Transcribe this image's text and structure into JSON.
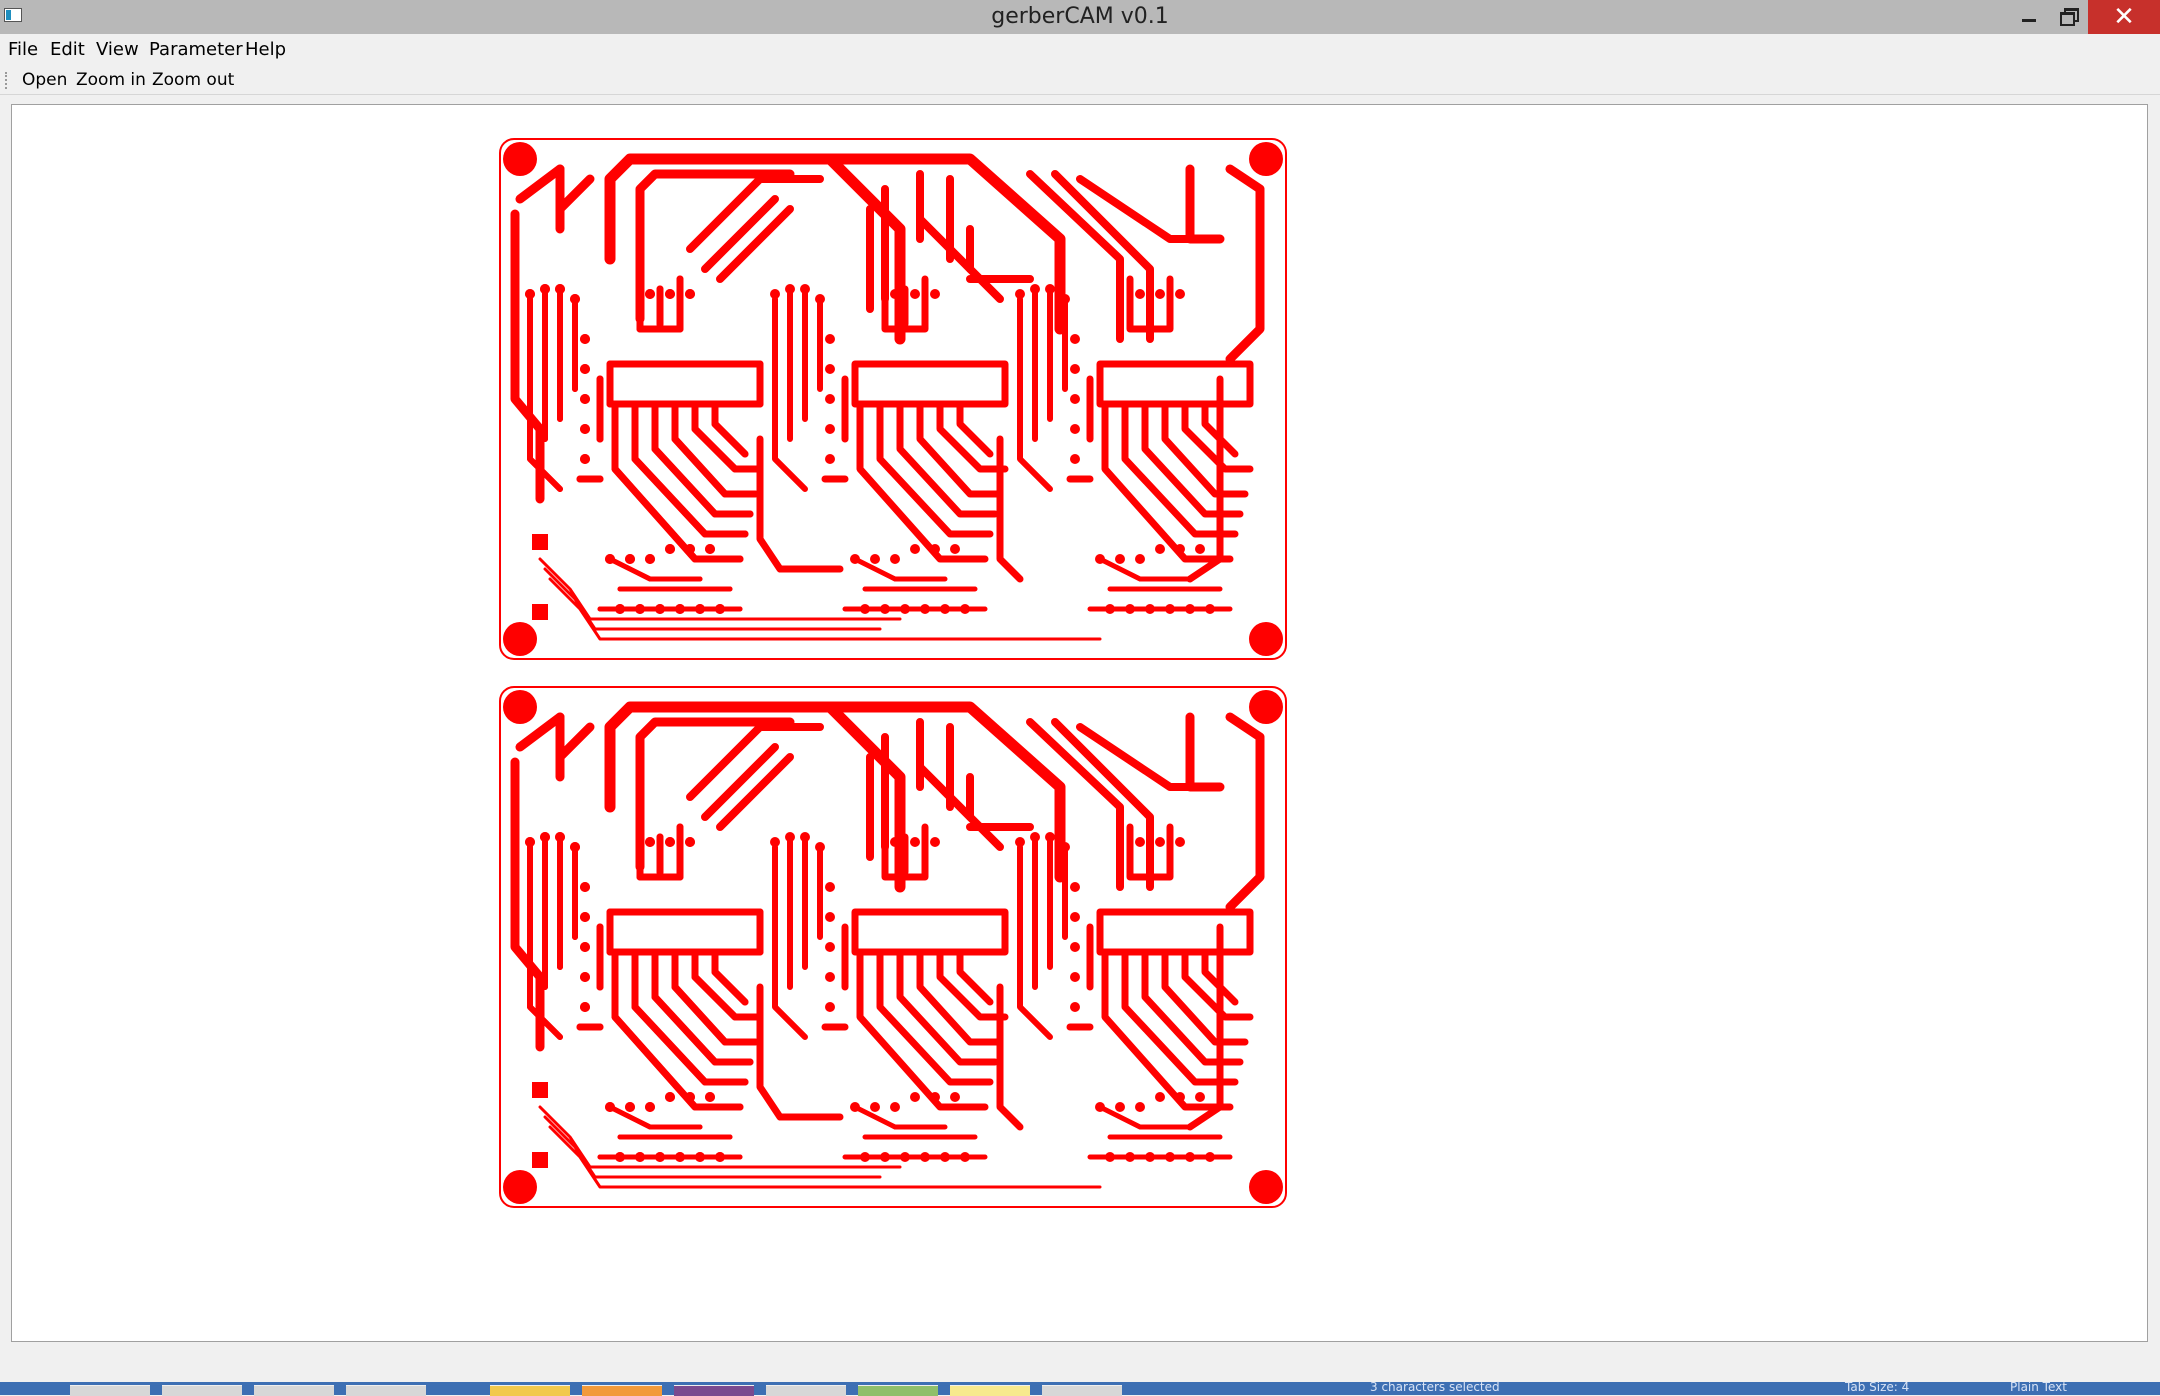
{
  "window": {
    "title": "gerberCAM v0.1",
    "close_glyph": "✕"
  },
  "menu": [
    "File",
    "Edit",
    "View",
    "Parameter",
    "Help"
  ],
  "toolbar": [
    "Open",
    "Zoom in",
    "Zoom out"
  ],
  "canvas": {
    "trace_color": "#ff0000",
    "boards": 2,
    "content": "PCB gerber trace preview (two identical boards)"
  },
  "taskbar": {
    "status_text": "3 characters selected",
    "tab_size_text": "Tab Size: 4",
    "mode_text": "Plain Text"
  }
}
